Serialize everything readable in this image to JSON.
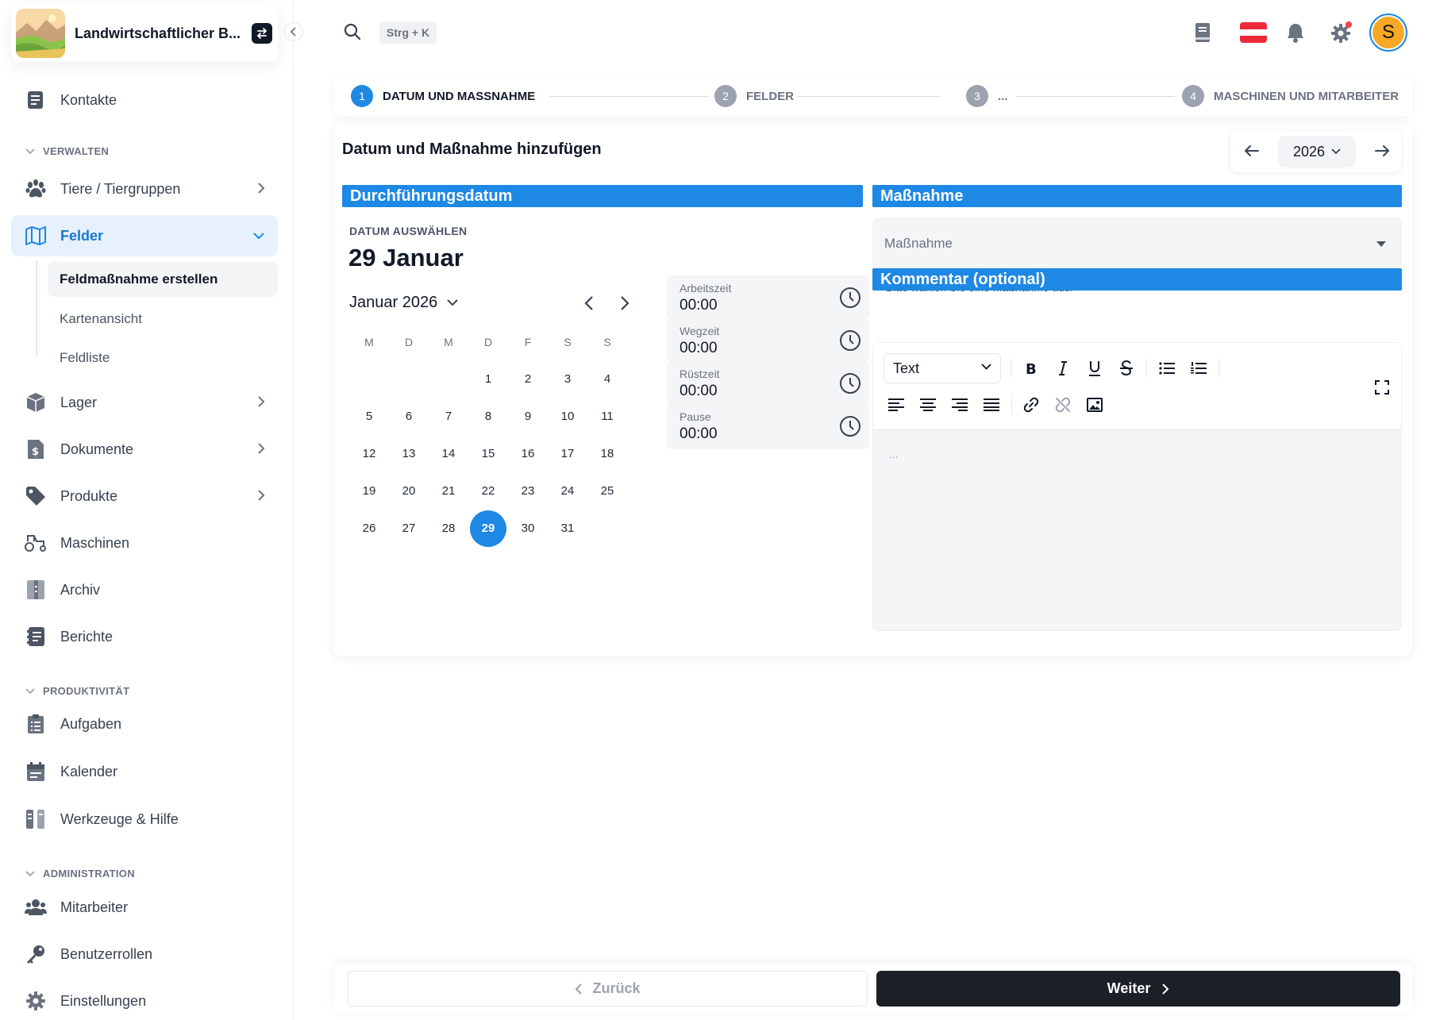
{
  "brand": {
    "title": "Landwirtschaftlicher B..."
  },
  "search": {
    "shortcut": "Strg + K"
  },
  "user": {
    "initial": "S"
  },
  "colors": {
    "accent": "#1e88e5",
    "primary_button": "#1b2026",
    "notification_dot": "#ef4444",
    "avatar": "#f9a825"
  },
  "sidebar": {
    "kontakte": "Kontakte",
    "sections": {
      "verwalten": "VERWALTEN",
      "produktivitaet": "PRODUKTIVITÄT",
      "administration": "ADMINISTRATION"
    },
    "tiere": "Tiere / Tiergruppen",
    "felder": "Felder",
    "felder_sub": [
      "Feldmaßnahme erstellen",
      "Kartenansicht",
      "Feldliste"
    ],
    "lager": "Lager",
    "dokumente": "Dokumente",
    "produkte": "Produkte",
    "maschinen": "Maschinen",
    "archiv": "Archiv",
    "berichte": "Berichte",
    "aufgaben": "Aufgaben",
    "kalender": "Kalender",
    "werkzeuge": "Werkzeuge & Hilfe",
    "mitarbeiter": "Mitarbeiter",
    "benutzerrollen": "Benutzerrollen",
    "einstellungen": "Einstellungen"
  },
  "stepper": [
    {
      "num": "1",
      "label": "DATUM UND MASSNAHME",
      "state": "current"
    },
    {
      "num": "2",
      "label": "FELDER",
      "state": "todo"
    },
    {
      "num": "3",
      "label": "...",
      "state": "todo"
    },
    {
      "num": "4",
      "label": "MASCHINEN UND MITARBEITER",
      "state": "todo"
    }
  ],
  "card": {
    "title": "Datum und Maßnahme hinzufügen",
    "year": "2026"
  },
  "date_section": {
    "header": "Durchführungsdatum",
    "pick_label": "DATUM AUSWÄHLEN",
    "selected_date": "29 Januar",
    "month_label": "Januar 2026",
    "weekdays": [
      "M",
      "D",
      "M",
      "D",
      "F",
      "S",
      "S"
    ],
    "weeks": [
      [
        "",
        "",
        "",
        "1",
        "2",
        "3",
        "4"
      ],
      [
        "5",
        "6",
        "7",
        "8",
        "9",
        "10",
        "11"
      ],
      [
        "12",
        "13",
        "14",
        "15",
        "16",
        "17",
        "18"
      ],
      [
        "19",
        "20",
        "21",
        "22",
        "23",
        "24",
        "25"
      ],
      [
        "26",
        "27",
        "28",
        "29",
        "30",
        "31",
        ""
      ]
    ],
    "selected_day": "29"
  },
  "times": [
    {
      "label": "Arbeitszeit",
      "value": "00:00"
    },
    {
      "label": "Wegzeit",
      "value": "00:00"
    },
    {
      "label": "Rüstzeit",
      "value": "00:00"
    },
    {
      "label": "Pause",
      "value": "00:00"
    }
  ],
  "massnahme": {
    "header": "Maßnahme",
    "placeholder": "Maßnahme",
    "help": "Bitte wählen Sie eine Maßnahme aus."
  },
  "kommentar": {
    "header": "Kommentar (optional)",
    "format": "Text",
    "placeholder": "..."
  },
  "footer": {
    "back": "Zurück",
    "next": "Weiter"
  }
}
